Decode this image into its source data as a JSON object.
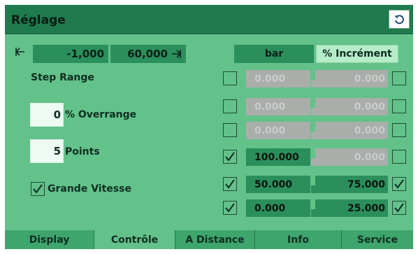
{
  "window": {
    "title": "Réglage",
    "refresh_icon": "refresh-icon"
  },
  "range": {
    "min": "-1,000",
    "max": "60,000",
    "unit": "bar",
    "mode": "% Incrément"
  },
  "step_range_label": "Step Range",
  "overrange": {
    "value": "0",
    "label": "% Overrange"
  },
  "points": {
    "value": "5",
    "label": "Points"
  },
  "grande_vitesse": {
    "label": "Grande Vitesse",
    "checked": true
  },
  "steps": [
    {
      "left_checked": false,
      "left": "0.000",
      "right": "0.000",
      "right_checked": false,
      "enabled_left": false,
      "enabled_right": false
    },
    {
      "left_checked": false,
      "left": "0.000",
      "right": "0.000",
      "right_checked": false,
      "enabled_left": false,
      "enabled_right": false
    },
    {
      "left_checked": false,
      "left": "0.000",
      "right": "0.000",
      "right_checked": false,
      "enabled_left": false,
      "enabled_right": false
    },
    {
      "left_checked": true,
      "left": "100.000",
      "right": "0.000",
      "right_checked": false,
      "enabled_left": true,
      "enabled_right": false
    },
    {
      "left_checked": true,
      "left": "50.000",
      "right": "75.000",
      "right_checked": true,
      "enabled_left": true,
      "enabled_right": true
    },
    {
      "left_checked": true,
      "left": "0.000",
      "right": "25.000",
      "right_checked": true,
      "enabled_left": true,
      "enabled_right": true
    }
  ],
  "tabs": [
    {
      "label": "Display",
      "active": false
    },
    {
      "label": "Contrôle",
      "active": true
    },
    {
      "label": "A Distance",
      "active": false
    },
    {
      "label": "Info",
      "active": false
    },
    {
      "label": "Service",
      "active": false
    }
  ],
  "colors": {
    "background": "#63c18a",
    "titlebar": "#1f7a4e",
    "cell_active": "#2b8f5c",
    "cell_disabled": "#a9aeab",
    "tab_inactive": "#3ea56d"
  }
}
